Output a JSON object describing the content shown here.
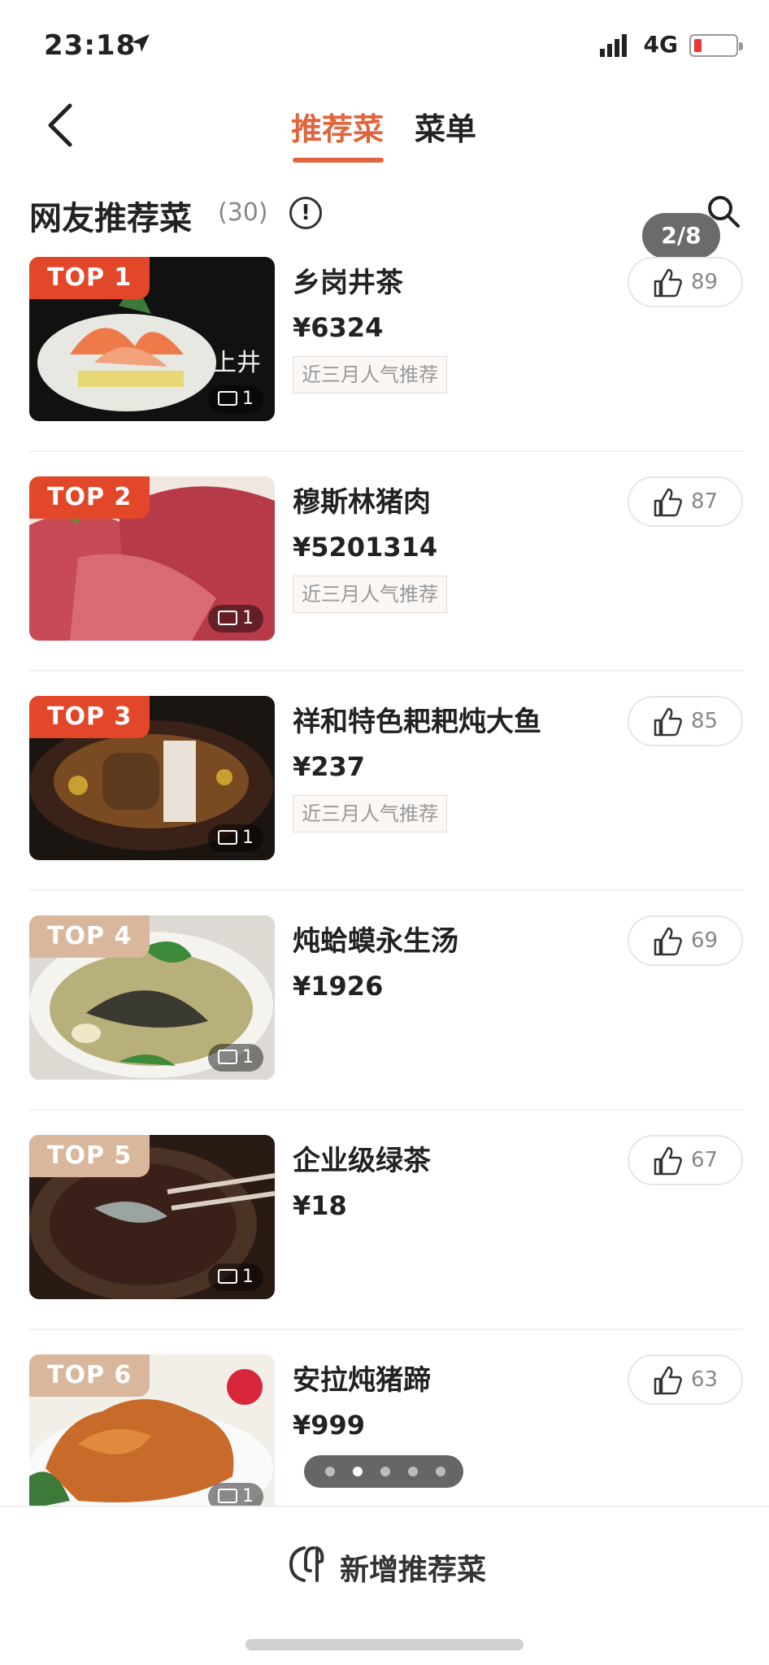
{
  "status": {
    "time": "23:18",
    "network": "4G"
  },
  "nav": {
    "tabs": [
      {
        "label": "推荐菜"
      },
      {
        "label": "菜单"
      }
    ]
  },
  "section": {
    "title": "网友推荐菜",
    "count": "(30)"
  },
  "page_indicator": "2/8",
  "dishes": [
    {
      "rank": "TOP 1",
      "name": "乡岗井茶",
      "price": "¥6324",
      "tag": "近三月人气推荐",
      "likes": "89",
      "image_count": "1"
    },
    {
      "rank": "TOP 2",
      "name": "穆斯林猪肉",
      "price": "¥5201314",
      "tag": "近三月人气推荐",
      "likes": "87",
      "image_count": "1"
    },
    {
      "rank": "TOP 3",
      "name": "祥和特色耙耙炖大鱼",
      "price": "¥237",
      "tag": "近三月人气推荐",
      "likes": "85",
      "image_count": "1"
    },
    {
      "rank": "TOP 4",
      "name": "炖蛤蟆永生汤",
      "price": "¥1926",
      "likes": "69",
      "image_count": "1"
    },
    {
      "rank": "TOP 5",
      "name": "企业级绿茶",
      "price": "¥18",
      "likes": "67",
      "image_count": "1"
    },
    {
      "rank": "TOP 6",
      "name": "安拉炖猪蹄",
      "price": "¥999",
      "likes": "63",
      "image_count": "1"
    }
  ],
  "carousel": {
    "total": 5,
    "active": 1
  },
  "bottom": {
    "add_label": "新增推荐菜"
  },
  "colors": {
    "accent": "#e0653d",
    "rank_hot": "#e2472a",
    "rank_warm": "#d8b79c"
  }
}
